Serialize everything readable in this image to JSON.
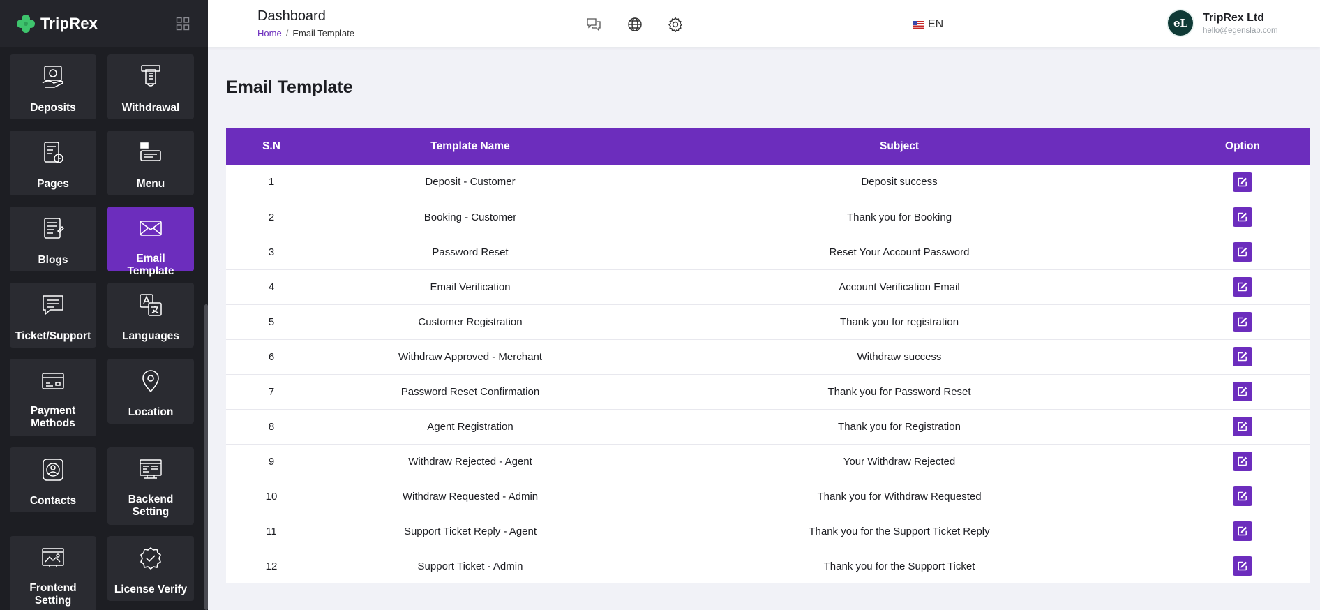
{
  "brand": {
    "name": "TripRex"
  },
  "sidebar": {
    "tiles": [
      {
        "label": "Deposits",
        "icon": "deposit-icon"
      },
      {
        "label": "Withdrawal",
        "icon": "withdrawal-icon"
      },
      {
        "label": "Pages",
        "icon": "pages-icon"
      },
      {
        "label": "Menu",
        "icon": "menu-icon"
      },
      {
        "label": "Blogs",
        "icon": "blogs-icon"
      },
      {
        "label": "Email Template",
        "icon": "envelope-icon",
        "active": true
      },
      {
        "label": "Ticket/Support",
        "icon": "ticket-icon"
      },
      {
        "label": "Languages",
        "icon": "languages-icon"
      },
      {
        "label": "Payment Methods",
        "icon": "payment-icon"
      },
      {
        "label": "Location",
        "icon": "location-pin-icon"
      },
      {
        "label": "Contacts",
        "icon": "contacts-icon"
      },
      {
        "label": "Backend Setting",
        "icon": "backend-setting-icon"
      },
      {
        "label": "Frontend Setting",
        "icon": "frontend-setting-icon"
      },
      {
        "label": "License Verify",
        "icon": "license-verify-icon"
      }
    ]
  },
  "header": {
    "title": "Dashboard",
    "breadcrumb": {
      "home": "Home",
      "separator": "/",
      "current": "Email Template"
    },
    "language": "EN",
    "user": {
      "initials": "eL",
      "name": "TripRex Ltd",
      "email": "hello@egenslab.com"
    }
  },
  "main": {
    "title": "Email Template",
    "table": {
      "columns": [
        "S.N",
        "Template Name",
        "Subject",
        "Option"
      ],
      "rows": [
        {
          "sn": "1",
          "name": "Deposit - Customer",
          "subject": "Deposit success"
        },
        {
          "sn": "2",
          "name": "Booking - Customer",
          "subject": "Thank you for Booking"
        },
        {
          "sn": "3",
          "name": "Password Reset",
          "subject": "Reset Your Account Password"
        },
        {
          "sn": "4",
          "name": "Email Verification",
          "subject": "Account Verification Email"
        },
        {
          "sn": "5",
          "name": "Customer Registration",
          "subject": "Thank you for registration"
        },
        {
          "sn": "6",
          "name": "Withdraw Approved - Merchant",
          "subject": "Withdraw success"
        },
        {
          "sn": "7",
          "name": "Password Reset Confirmation",
          "subject": "Thank you for Password Reset"
        },
        {
          "sn": "8",
          "name": "Agent Registration",
          "subject": "Thank you for Registration"
        },
        {
          "sn": "9",
          "name": "Withdraw Rejected - Agent",
          "subject": "Your Withdraw Rejected"
        },
        {
          "sn": "10",
          "name": "Withdraw Requested - Admin",
          "subject": "Thank you for Withdraw Requested"
        },
        {
          "sn": "11",
          "name": "Support Ticket Reply - Agent",
          "subject": "Thank you for the Support Ticket Reply"
        },
        {
          "sn": "12",
          "name": "Support Ticket - Admin",
          "subject": "Thank you for the Support Ticket"
        }
      ]
    }
  },
  "colors": {
    "accent": "#6c2dbd",
    "sidebar_bg": "#1d1e23",
    "tile_bg": "#2a2b31",
    "page_bg": "#f1f2f7"
  }
}
